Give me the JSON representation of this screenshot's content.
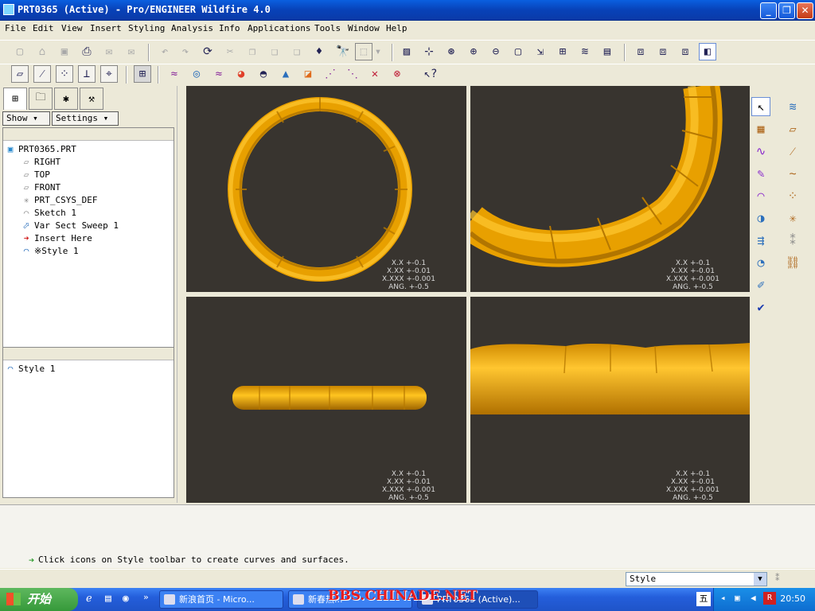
{
  "window": {
    "title": "PRT0365 (Active) - Pro/ENGINEER Wildfire 4.0",
    "min_glyph": "_",
    "max_glyph": "❐",
    "close_glyph": "✕"
  },
  "menu": [
    "File",
    "Edit",
    "View",
    "Insert",
    "Styling",
    "Analysis",
    "Info",
    "Applications",
    "Tools",
    "Window",
    "Help"
  ],
  "left_panel": {
    "tabs": [
      "model-tree-icon",
      "folder-browser-icon",
      "favorites-icon",
      "connections-icon"
    ],
    "show_label": "Show ▾",
    "settings_label": "Settings ▾",
    "tree": [
      {
        "label": "PRT0365.PRT",
        "icon": "part-icon"
      },
      {
        "label": "RIGHT",
        "icon": "datum-plane-icon"
      },
      {
        "label": "TOP",
        "icon": "datum-plane-icon"
      },
      {
        "label": "FRONT",
        "icon": "datum-plane-icon"
      },
      {
        "label": "PRT_CSYS_DEF",
        "icon": "csys-icon"
      },
      {
        "label": "Sketch 1",
        "icon": "sketch-icon"
      },
      {
        "label": "Var Sect Sweep 1",
        "icon": "sweep-icon"
      },
      {
        "label": "Insert Here",
        "icon": "insert-arrow-icon"
      },
      {
        "label": "※Style 1",
        "icon": "style-icon"
      }
    ],
    "layer_item": "Style 1"
  },
  "viewports": {
    "tolerance": [
      "X.X +-0.1",
      "X.XX +-0.01",
      "X.XXX +-0.001",
      "ANG. +-0.5"
    ]
  },
  "message": "Click icons on Style toolbar to create curves and surfaces.",
  "status": {
    "filter_value": "Style"
  },
  "taskbar": {
    "start_label": "开始",
    "tasks": [
      "新浪首页 - Micro...",
      "新春热...",
      "PRT0365 (Active)..."
    ],
    "watermark": "BBS.CHINADE.NET",
    "tray_ime": "五",
    "clock": "20:50"
  },
  "colors": {
    "ring_gold": "#f0a400",
    "viewport_bg": "#38342f",
    "titlebar_blue": "#0a5fe0"
  }
}
